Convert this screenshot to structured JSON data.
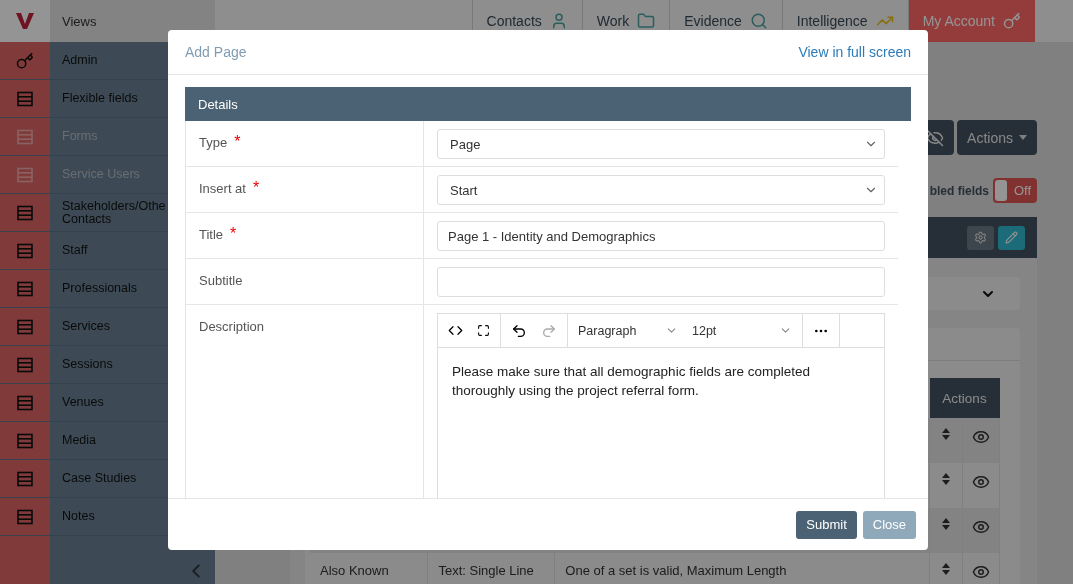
{
  "top_bar": {
    "views_label": "Views",
    "tabs": [
      {
        "label": "Contacts",
        "selected": false
      },
      {
        "label": "Work",
        "selected": false
      },
      {
        "label": "Evidence",
        "selected": false
      },
      {
        "label": "Intelligence",
        "selected": false
      },
      {
        "label": "My Account",
        "selected": true
      }
    ]
  },
  "sidebar": {
    "items": [
      {
        "label": "Admin",
        "kind": "key",
        "disabled": false
      },
      {
        "label": "Flexible fields",
        "kind": "list",
        "disabled": false
      },
      {
        "label": "Forms",
        "kind": "list",
        "disabled": true
      },
      {
        "label": "Service Users",
        "kind": "list",
        "disabled": true
      },
      {
        "label": "Stakeholders/Othe Contacts",
        "kind": "list",
        "disabled": false
      },
      {
        "label": "Staff",
        "kind": "list",
        "disabled": false
      },
      {
        "label": "Professionals",
        "kind": "list",
        "disabled": false
      },
      {
        "label": "Services",
        "kind": "list",
        "disabled": false
      },
      {
        "label": "Sessions",
        "kind": "list",
        "disabled": false
      },
      {
        "label": "Venues",
        "kind": "list",
        "disabled": false
      },
      {
        "label": "Media",
        "kind": "list",
        "disabled": false
      },
      {
        "label": "Case Studies",
        "kind": "list",
        "disabled": false
      },
      {
        "label": "Notes",
        "kind": "list",
        "disabled": false
      }
    ]
  },
  "page": {
    "actions_button": "Actions",
    "fields_toggle": {
      "label": "bled fields",
      "state_label": "Off",
      "on": false
    },
    "table": {
      "header": "Actions",
      "rows": [
        {
          "cells": []
        },
        {
          "cells": []
        },
        {
          "cells": []
        },
        {
          "cells": [
            "Also Known",
            "Text: Single Line",
            "One of a set is valid, Maximum Length"
          ]
        }
      ]
    }
  },
  "modal": {
    "title": "Add Page",
    "full_screen_link": "View in full screen",
    "panel_title": "Details",
    "fields": [
      {
        "kind": "select",
        "label": "Type",
        "required_mark": "*",
        "value": "Page"
      },
      {
        "kind": "select",
        "label": "Insert at",
        "required_mark": "*",
        "value": "Start"
      },
      {
        "kind": "text",
        "label": "Title",
        "required_mark": "*",
        "value": "Page 1 - Identity and Demographics"
      },
      {
        "kind": "text",
        "label": "Subtitle"
      },
      {
        "kind": "editor",
        "label": "Description",
        "block_format": "Paragraph",
        "font_size": "12pt",
        "value": "Please make sure that all demographic fields are completed thoroughly using the project referral form."
      }
    ],
    "buttons": [
      {
        "label": "Submit",
        "kind": "primary"
      },
      {
        "label": "Close",
        "kind": "secondary"
      }
    ]
  }
}
